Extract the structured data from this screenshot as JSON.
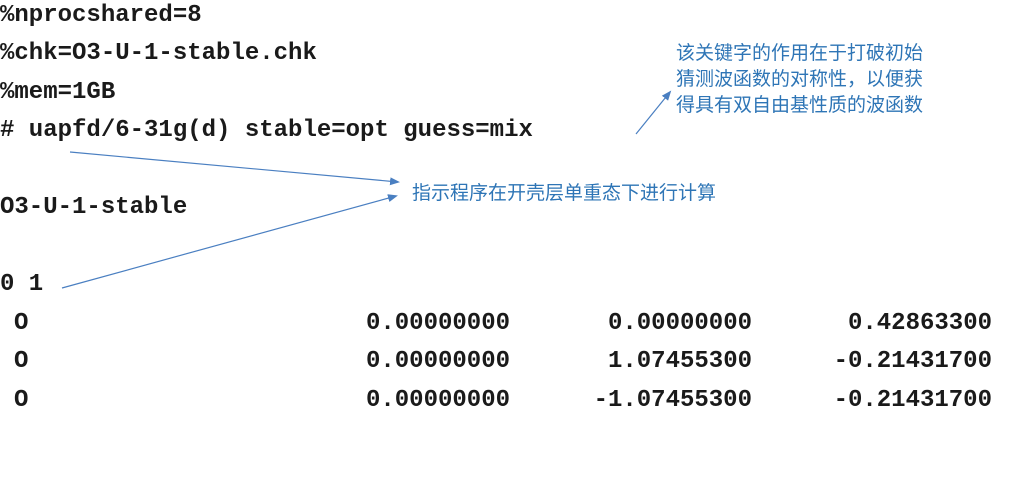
{
  "input_file": {
    "nprocshared": "%nprocshared=8",
    "chk": "%chk=O3-U-1-stable.chk",
    "mem": "%mem=1GB",
    "route": "# uapfd/6-31g(d) stable=opt guess=mix",
    "title": "O3-U-1-stable",
    "charge_multiplicity": "0 1",
    "atoms": [
      {
        "symbol": "O",
        "x": "0.00000000",
        "y": "0.00000000",
        "z": "0.42863300"
      },
      {
        "symbol": "O",
        "x": "0.00000000",
        "y": "1.07455300",
        "z": "-0.21431700"
      },
      {
        "symbol": "O",
        "x": "0.00000000",
        "y": "-1.07455300",
        "z": "-0.21431700"
      }
    ]
  },
  "annotations": {
    "guess_mix_note": [
      "该关键字的作用在于打破初始",
      "猜测波函数的对称性，以便获",
      "得具有双自由基性质的波函数"
    ],
    "open_shell_note": "指示程序在开壳层单重态下进行计算"
  },
  "colors": {
    "annotation": "#2e75b6",
    "code_text": "#1a1a1a"
  }
}
